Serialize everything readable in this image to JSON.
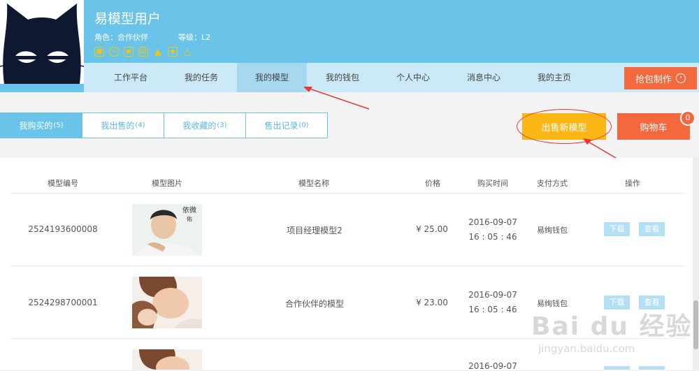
{
  "user": {
    "name": "易模型用户",
    "role_label": "角色：合作伙伴",
    "level_label": "等级：L2",
    "badges": [
      "badge-1-icon",
      "badge-2-icon",
      "badge-3-icon",
      "badge-4-icon",
      "badge-5-icon",
      "badge-6-icon",
      "badge-7-icon"
    ]
  },
  "nav": {
    "items": [
      "工作平台",
      "我的任务",
      "我的模型",
      "我的钱包",
      "个人中心",
      "消息中心",
      "我的主页"
    ],
    "active": "我的模型",
    "grab_button": "抢包制作"
  },
  "tabs": [
    {
      "label": "我购买的",
      "count": "(5)",
      "active": true
    },
    {
      "label": "我出售的",
      "count": "(4)",
      "active": false
    },
    {
      "label": "我收藏的",
      "count": "(3)",
      "active": false
    },
    {
      "label": "售出记录",
      "count": "(0)",
      "active": false
    }
  ],
  "actions": {
    "sell_new": "出售新模型",
    "cart": "购物车",
    "cart_count": "0"
  },
  "table": {
    "headers": [
      "模型编号",
      "模型图片",
      "模型名称",
      "价格",
      "购买时间",
      "支付方式",
      "操作"
    ],
    "rows": [
      {
        "id": "2524193600008",
        "name": "项目经理模型2",
        "price": "¥ 25.00",
        "date": "2016-09-07",
        "time": "16 : 05 : 46",
        "pay": "易绚钱包",
        "download": "下载",
        "view": "查看"
      },
      {
        "id": "2524298700001",
        "name": "合作伙伴的模型",
        "price": "¥ 23.00",
        "date": "2016-09-07",
        "time": "16 : 05 : 46",
        "pay": "易绚钱包",
        "download": "下载",
        "view": "查看"
      },
      {
        "id": "",
        "name": "",
        "price": "",
        "date": "2016-09-07",
        "time": "",
        "pay": "",
        "download": "",
        "view": ""
      }
    ]
  },
  "watermark": {
    "brand": "Bai du 经验",
    "url": "jingyan.baidu.com"
  },
  "colors": {
    "header": "#6ac4ea",
    "nav": "#cce9f7",
    "accent_orange": "#f4683e",
    "accent_yellow": "#fbb715",
    "annotation_red": "#e53935"
  }
}
